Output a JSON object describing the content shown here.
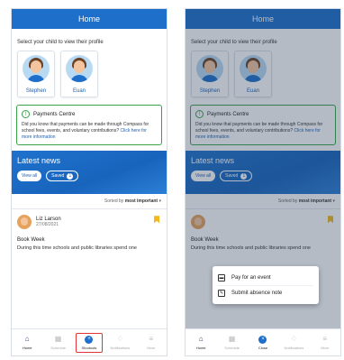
{
  "screens": [
    {
      "header_title": "Home",
      "select_text": "Select your child to view their profile",
      "children": [
        {
          "name": "Stephen"
        },
        {
          "name": "Euan"
        }
      ],
      "payments": {
        "title": "Payments Centre",
        "body": "Did you know that payments can be made through Compass for school fees, events, and voluntary contributions?",
        "link": "Click here for more information"
      },
      "news": {
        "title": "Latest news",
        "view_all": "View all",
        "saved": "Saved",
        "saved_count": "1"
      },
      "sort": {
        "prefix": "Sorted by",
        "value": "most important"
      },
      "post": {
        "author": "Liz Larson",
        "date": "27/08/2021",
        "title": "Book Week",
        "body": "During this time schools and public libraries spend one"
      },
      "tabs": [
        {
          "label": "Home",
          "icon": "home-icon"
        },
        {
          "label": "Schedule",
          "icon": "calendar-icon"
        },
        {
          "label": "Shortcuts",
          "icon": "shortcuts-icon"
        },
        {
          "label": "Notifications",
          "icon": "bell-icon"
        },
        {
          "label": "More",
          "icon": "menu-icon"
        }
      ]
    },
    {
      "header_title": "Home",
      "select_text": "Select your child to view their profile",
      "children": [
        {
          "name": "Stephen"
        },
        {
          "name": "Euan"
        }
      ],
      "payments": {
        "title": "Payments Centre",
        "body": "Did you know that payments can be made through Compass for school fees, events, and voluntary contributions?",
        "link": "Click here for more information"
      },
      "news": {
        "title": "Latest news",
        "view_all": "View all",
        "saved": "Saved",
        "saved_count": "1"
      },
      "sort": {
        "prefix": "Sorted by",
        "value": "most important"
      },
      "post": {
        "title": "Book Week",
        "body": "During this time schools and public libraries spend one"
      },
      "popup": [
        {
          "label": "Pay for an event",
          "icon": "payment-card-icon"
        },
        {
          "label": "Submit absence note",
          "icon": "edit-note-icon"
        }
      ],
      "tabs": [
        {
          "label": "Home",
          "icon": "home-icon"
        },
        {
          "label": "Schedule",
          "icon": "calendar-icon"
        },
        {
          "label": "Close",
          "icon": "close-icon"
        },
        {
          "label": "Notifications",
          "icon": "bell-icon"
        },
        {
          "label": "More",
          "icon": "menu-icon"
        }
      ]
    }
  ],
  "colors": {
    "primary": "#1e6fc9",
    "payments_border": "#3aa34a",
    "highlight": "#e0343a",
    "bookmark": "#f2b91e"
  }
}
